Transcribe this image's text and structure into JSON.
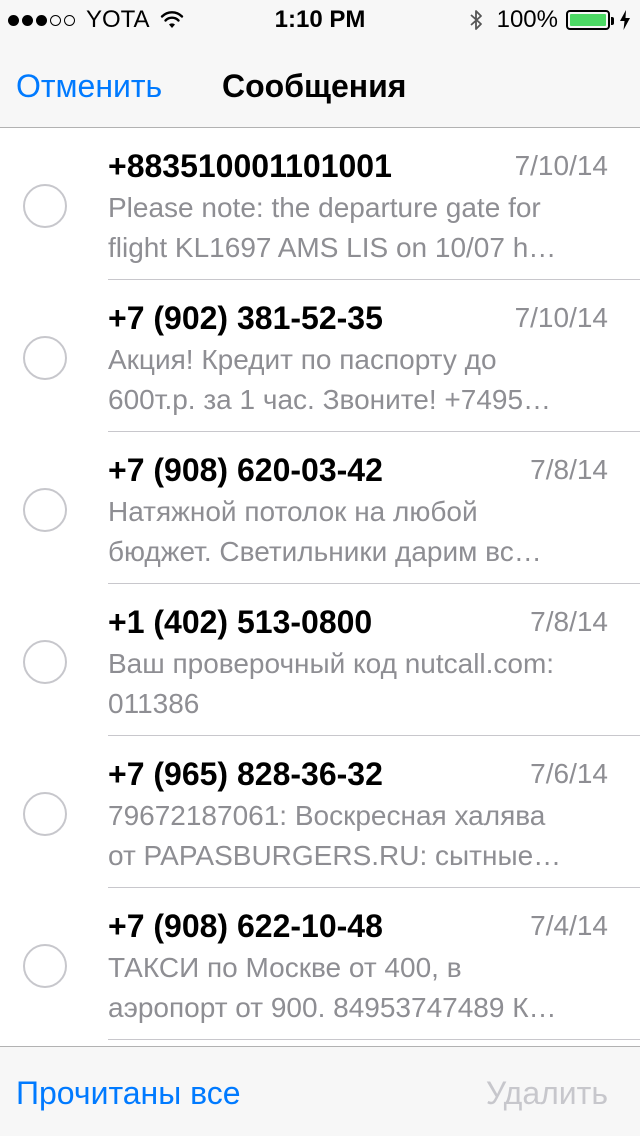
{
  "status_bar": {
    "carrier": "YOTA",
    "time": "1:10 PM",
    "battery_percent": "100%",
    "signal_bars_filled": 3,
    "signal_bars_total": 5,
    "battery_level": 1.0,
    "battery_color": "#4cd964",
    "icons": [
      "wifi-icon",
      "bluetooth-icon",
      "battery-icon",
      "charging-icon"
    ]
  },
  "nav": {
    "cancel_label": "Отменить",
    "title": "Сообщения"
  },
  "messages": [
    {
      "sender": "+883510001101001",
      "date": "7/10/14",
      "preview_line1": "Please note: the departure gate for",
      "preview_line2": "flight KL1697 AMS LIS on 10/07 h…"
    },
    {
      "sender": "+7 (902) 381-52-35",
      "date": "7/10/14",
      "preview_line1": "Акция! Кредит по паспорту до",
      "preview_line2": "600т.р. за 1 час. Звоните! +7495…"
    },
    {
      "sender": "+7 (908) 620-03-42",
      "date": "7/8/14",
      "preview_line1": "Натяжной потолок на любой",
      "preview_line2": "бюджет. Светильники дарим вс…"
    },
    {
      "sender": "+1 (402) 513-0800",
      "date": "7/8/14",
      "preview_line1": "Ваш проверочный код nutcall.com:",
      "preview_line2": "011386"
    },
    {
      "sender": "+7 (965) 828-36-32",
      "date": "7/6/14",
      "preview_line1": "79672187061: Воскресная халява",
      "preview_line2": "от PAPASBURGERS.RU: сытные…"
    },
    {
      "sender": "+7 (908) 622-10-48",
      "date": "7/4/14",
      "preview_line1": "ТАКСИ по Москве от 400, в",
      "preview_line2": "аэропорт от 900. 84953747489 К…"
    }
  ],
  "toolbar": {
    "mark_read_label": "Прочитаны все",
    "delete_label": "Удалить"
  },
  "colors": {
    "accent": "#007aff",
    "secondary_text": "#8e8e93",
    "disabled": "#c7c7cc"
  }
}
